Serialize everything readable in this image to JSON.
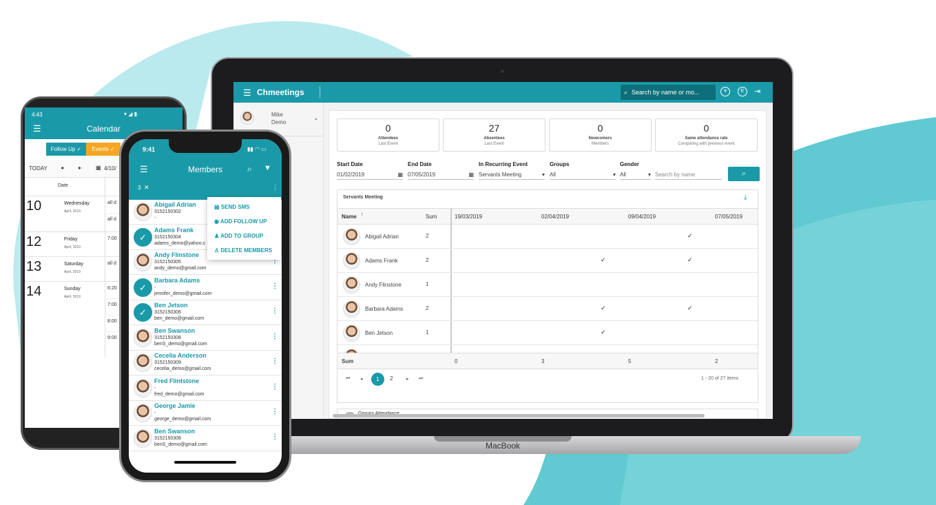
{
  "laptop": {
    "brand_label": "MacBook",
    "app_name": "Chmeetings",
    "search_placeholder": "Search by name or mo...",
    "user_name": "Mike",
    "user_last": "Demo",
    "stats": [
      {
        "value": "0",
        "label": "Attendees",
        "sub": "Last Event"
      },
      {
        "value": "27",
        "label": "Absentees",
        "sub": "Last Event"
      },
      {
        "value": "0",
        "label": "Newcomers",
        "sub": "Members"
      },
      {
        "value": "0",
        "label": "Same attendance rate",
        "sub": "Comparing with previous event"
      }
    ],
    "filters": {
      "start_label": "Start Date",
      "start_value": "01/02/2019",
      "end_label": "End Date",
      "end_value": "07/05/2019",
      "recurring_label": "In Recurring Event",
      "recurring_value": "Servants Meeting",
      "groups_label": "Groups",
      "groups_value": "All",
      "gender_label": "Gender",
      "gender_value": "All",
      "search_placeholder": "Search by name"
    },
    "grid": {
      "title": "Servants Meeting",
      "col_name": "Name",
      "col_sum": "Sum",
      "dates": [
        "19/03/2019",
        "02/04/2019",
        "09/04/2019",
        "07/05/2019"
      ],
      "rows": [
        {
          "name": "Abigail Adrian",
          "sum": "2",
          "checks": [
            false,
            false,
            true,
            true
          ]
        },
        {
          "name": "Adams Frank",
          "sum": "2",
          "checks": [
            false,
            true,
            true,
            false
          ]
        },
        {
          "name": "Andy Flinstone",
          "sum": "1",
          "checks": [
            false,
            false,
            false,
            true
          ]
        },
        {
          "name": "Barbara Adams",
          "sum": "2",
          "checks": [
            false,
            true,
            true,
            false
          ]
        },
        {
          "name": "Ben Jetson",
          "sum": "1",
          "checks": [
            false,
            true,
            false,
            false
          ]
        }
      ],
      "sum_label": "Sum",
      "sums": [
        "0",
        "3",
        "5",
        "2"
      ],
      "pages": [
        "1",
        "2"
      ],
      "page_info": "1 - 20 of 27 items",
      "groups_attendance": "Groups Attendance"
    }
  },
  "android": {
    "time": "4:43",
    "title": "Calendar",
    "toggle_followup": "Follow Up",
    "toggle_events": "Events",
    "today": "TODAY",
    "date_short": "4/10/",
    "date_col": "Date",
    "days": [
      {
        "num": "10",
        "weekday": "Wednesday",
        "date": "April, 2019",
        "events": [
          "all d",
          "all d"
        ]
      },
      {
        "num": "12",
        "weekday": "Friday",
        "date": "April, 2019",
        "events": [
          "7:00"
        ]
      },
      {
        "num": "13",
        "weekday": "Saturday",
        "date": "April, 2019",
        "events": [
          "all d"
        ]
      },
      {
        "num": "14",
        "weekday": "Sunday",
        "date": "April, 2019",
        "events": [
          "6:20",
          "7:00",
          "8:00",
          "9:00"
        ]
      }
    ]
  },
  "iphone": {
    "time": "9:41",
    "title": "Members",
    "selected_count": "3",
    "menu": [
      "SEND SMS",
      "ADD FOLLOW UP",
      "ADD TO GROUP",
      "DELETE MEMBERS"
    ],
    "members": [
      {
        "name": "Abigail Adrian",
        "phone": "3152150302",
        "email": "-",
        "checked": false
      },
      {
        "name": "Adams Frank",
        "phone": "3152150304",
        "email": "adams_demo@yahoo.c",
        "checked": true
      },
      {
        "name": "Andy Flinstone",
        "phone": "3152150305",
        "email": "andy_demo@gmail.com",
        "checked": false
      },
      {
        "name": "Barbara Adams",
        "phone": "-",
        "email": "jennifer_demo@gmail.com",
        "checked": true
      },
      {
        "name": "Ben Jetson",
        "phone": "3152150306",
        "email": "ben_demo@gmail.com",
        "checked": true
      },
      {
        "name": "Ben Swanson",
        "phone": "3152150308",
        "email": "benS_demo@gmail.com",
        "checked": false
      },
      {
        "name": "Cecelia Anderson",
        "phone": "3152150309",
        "email": "cecelia_demo@gmail.com",
        "checked": false
      },
      {
        "name": "Fred Flintstone",
        "phone": "-",
        "email": "fred_demo@gmail.com",
        "checked": false
      },
      {
        "name": "George Jamie",
        "phone": "-",
        "email": "george_demo@gmail.com",
        "checked": false
      },
      {
        "name": "Ben Swanson",
        "phone": "3152150308",
        "email": "benS_demo@gmail.com",
        "checked": false
      }
    ]
  },
  "colors": {
    "accent": "#1a9aa8",
    "orange": "#f5a623"
  }
}
